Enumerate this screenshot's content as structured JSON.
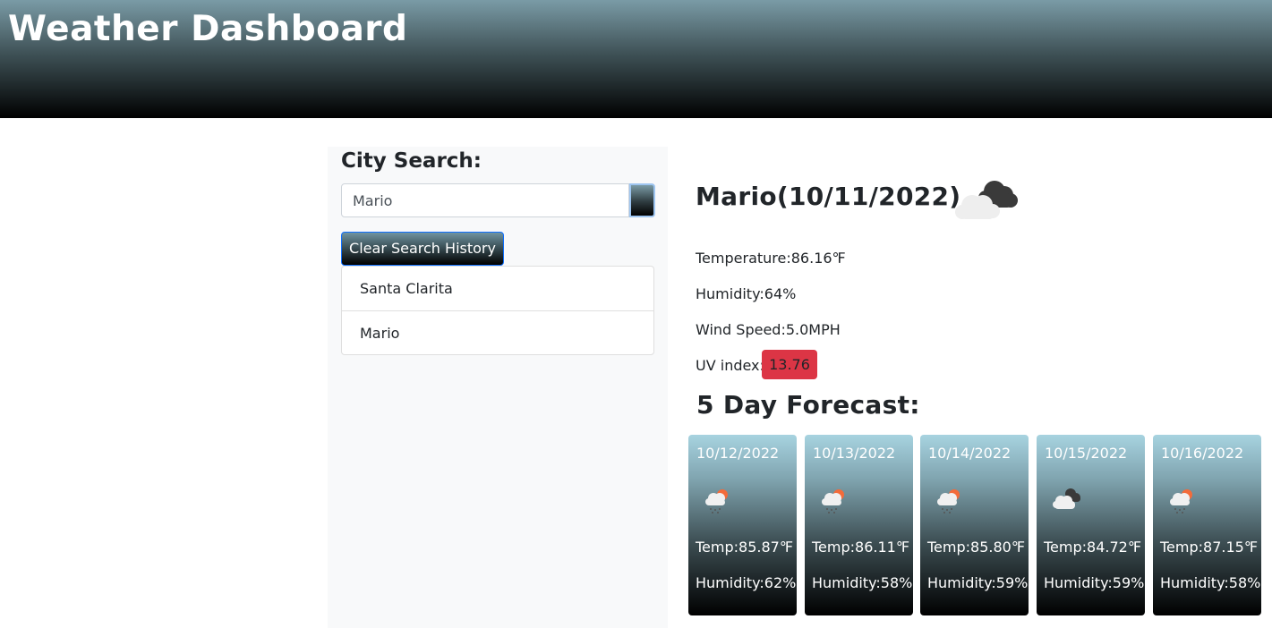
{
  "header": {
    "title": "Weather Dashboard"
  },
  "search": {
    "heading": "City Search:",
    "input_value": "Mario",
    "clear_label": "Clear Search History",
    "history": [
      "Santa Clarita",
      "Mario"
    ]
  },
  "current": {
    "title": "Mario(10/11/2022)",
    "icon": "clouds-icon",
    "temperature": "Temperature:86.16℉",
    "humidity": "Humidity:64%",
    "wind": "Wind Speed:5.0MPH",
    "uv_label": "UV index:",
    "uv_value": "13.76",
    "uv_color": "#dc3545"
  },
  "forecast": {
    "heading": "5 Day Forecast:",
    "days": [
      {
        "date": "10/12/2022",
        "icon": "rain-sun-icon",
        "temp": "Temp:85.87℉",
        "humidity": "Humidity:62%"
      },
      {
        "date": "10/13/2022",
        "icon": "rain-sun-icon",
        "temp": "Temp:86.11℉",
        "humidity": "Humidity:58%"
      },
      {
        "date": "10/14/2022",
        "icon": "rain-sun-icon",
        "temp": "Temp:85.80℉",
        "humidity": "Humidity:59%"
      },
      {
        "date": "10/15/2022",
        "icon": "clouds-icon",
        "temp": "Temp:84.72℉",
        "humidity": "Humidity:59%"
      },
      {
        "date": "10/16/2022",
        "icon": "rain-sun-icon",
        "temp": "Temp:87.15℉",
        "humidity": "Humidity:58%"
      }
    ]
  }
}
